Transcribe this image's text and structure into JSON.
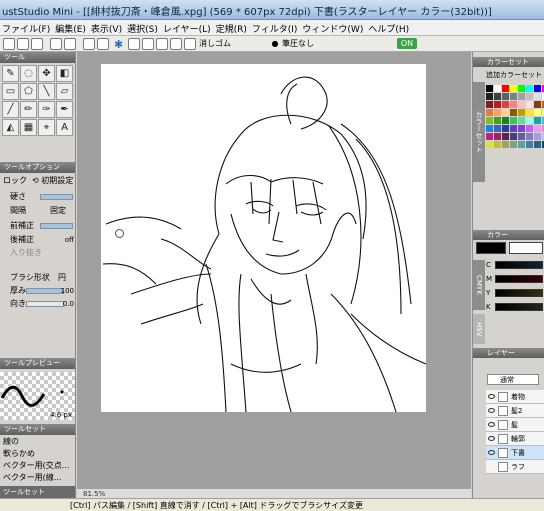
{
  "title": "ustStudio Mini - [[緋村抜刀斎・峰倉風.xpg] (569 * 607px 72dpi)     下書(ラスターレイヤー カラー(32bit))]",
  "menu": [
    "ファイル(F)",
    "編集(E)",
    "表示(V)",
    "選択(S)",
    "レイヤー(L)",
    "定規(R)",
    "フィルタ(I)",
    "ウィンドウ(W)",
    "ヘルプ(H)"
  ],
  "toolbar": {
    "eraser_label": "消しゴム",
    "pressure_label": "筆圧なし",
    "toggle_label": "ON"
  },
  "left": {
    "tools_title": "ツール",
    "tool_options_title": "ツールオプション",
    "lock_label": "ロック",
    "reset_label": "初期設定",
    "hardness_label": "硬さ",
    "interval_label": "間隔",
    "interval_value": "固定",
    "correction_label": "前補正",
    "post_correction_label": "後補正",
    "post_correction_value": "off",
    "pressure_label": "入り抜き",
    "brush_shape_label": "ブラシ形状",
    "brush_shape_value": "円",
    "thickness_label": "厚み",
    "thickness_value": "100",
    "direction_label": "向き",
    "direction_value": "0.0",
    "preview_title": "ツールプレビュー",
    "preview_size": "4.6 px",
    "toolset_title": "ツールセット",
    "toolset_items": [
      "線の",
      "軟らかめ",
      "ベクター用(交点...",
      "ベクター用(線..."
    ],
    "toolset_tab": "ツールセット"
  },
  "canvas": {
    "zoom": "81.5%"
  },
  "hint": "[Ctrl] パス編集 / [Shift] 直線で消す / [Ctrl] + [Alt] ドラッグでブラシサイズ変更",
  "right": {
    "colorset_title": "カラーセット",
    "add_colorset": "追加カラーセット",
    "colorset_tab": "カラーセット",
    "color_title": "カラー",
    "color_tab": "CMYK",
    "hsv_tab": "HSV",
    "channels": [
      "C",
      "M",
      "Y",
      "K"
    ],
    "layer_title": "レイヤー",
    "blend_mode": "通常",
    "layers": [
      "着物",
      "髪2",
      "髪",
      "輪郭",
      "下書",
      "ラフ"
    ]
  },
  "palette_colors": [
    "#000000",
    "#ffffff",
    "#ff0000",
    "#ffff00",
    "#00ff00",
    "#00ffff",
    "#0000ff",
    "#ff00ff",
    "#202020",
    "#404040",
    "#606060",
    "#808080",
    "#a0a0a0",
    "#c0c0c0",
    "#e0e0e0",
    "#ffffff",
    "#7f1f1f",
    "#b02020",
    "#e04040",
    "#ff8080",
    "#ffc0c0",
    "#ffe0e0",
    "#804020",
    "#c06020",
    "#e08040",
    "#ffa060",
    "#ffd0a0",
    "#806000",
    "#c0a000",
    "#ffe040",
    "#ffff80",
    "#e0ff80",
    "#80c020",
    "#40a020",
    "#208020",
    "#40c060",
    "#60e0a0",
    "#a0ffe0",
    "#20a0a0",
    "#40c0e0",
    "#2080e0",
    "#4060c0",
    "#2040a0",
    "#6040c0",
    "#8040e0",
    "#c060ff",
    "#e0a0ff",
    "#ff80c0",
    "#c02080",
    "#a02060",
    "#602040",
    "#404080",
    "#6060a0",
    "#8080c0",
    "#a0a0e0",
    "#c0c0ff",
    "#e0e040",
    "#c0c040",
    "#a0a060",
    "#80a080",
    "#60a0a0",
    "#4080a0",
    "#306080",
    "#204060"
  ],
  "accent_colors": {
    "title_bg": "#9bbde0",
    "canvas_bg": "#a0a0a0",
    "slider": "#a9c2dc",
    "fg_color": "#000000"
  }
}
